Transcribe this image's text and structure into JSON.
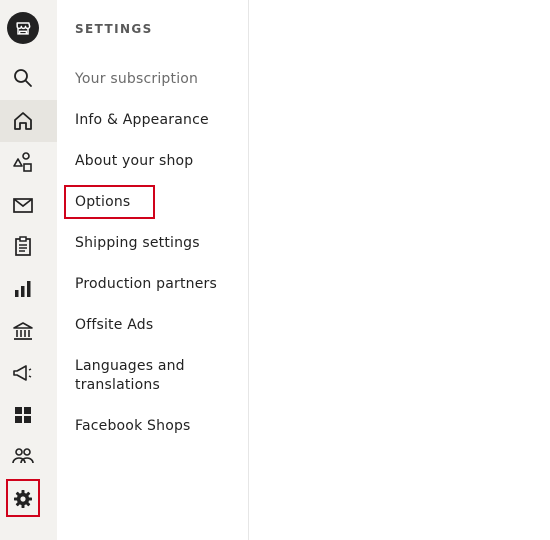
{
  "colors": {
    "rail_bg": "#f3f2ef",
    "rail_active": "#e7e5e0",
    "highlight": "#d0021b",
    "text": "#222222"
  },
  "rail": {
    "items": [
      {
        "name": "search",
        "icon": "search-icon"
      },
      {
        "name": "dashboard",
        "icon": "home-icon",
        "active": true
      },
      {
        "name": "listings",
        "icon": "shapes-icon"
      },
      {
        "name": "messages",
        "icon": "mail-icon"
      },
      {
        "name": "orders",
        "icon": "clipboard-icon"
      },
      {
        "name": "stats",
        "icon": "bar-chart-icon"
      },
      {
        "name": "finances",
        "icon": "bank-icon"
      },
      {
        "name": "marketing",
        "icon": "megaphone-icon"
      },
      {
        "name": "integrations",
        "icon": "grid-icon"
      },
      {
        "name": "community",
        "icon": "people-icon"
      },
      {
        "name": "settings",
        "icon": "gear-icon",
        "highlighted": true
      }
    ]
  },
  "settings_menu": {
    "heading": "SETTINGS",
    "items": [
      {
        "label": "Your subscription"
      },
      {
        "label": "Info & Appearance"
      },
      {
        "label": "About your shop"
      },
      {
        "label": "Options",
        "highlighted": true
      },
      {
        "label": "Shipping settings"
      },
      {
        "label": "Production partners"
      },
      {
        "label": "Offsite Ads"
      },
      {
        "label": "Languages and translations"
      },
      {
        "label": "Facebook Shops"
      }
    ]
  }
}
